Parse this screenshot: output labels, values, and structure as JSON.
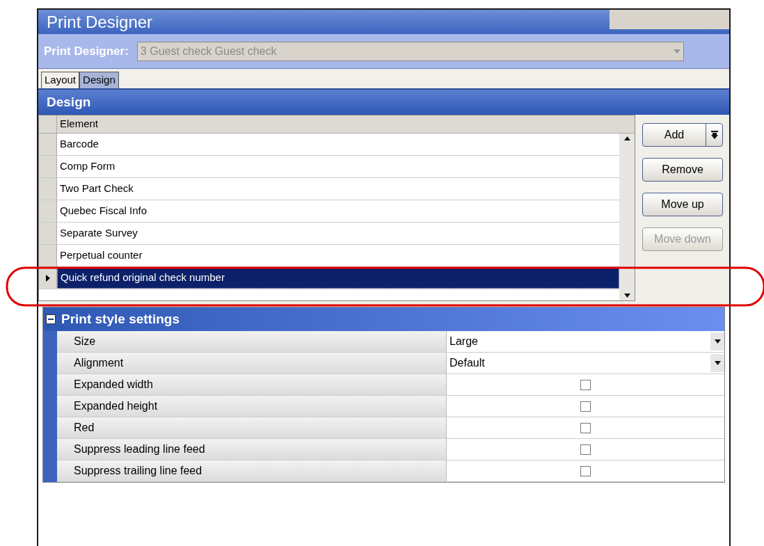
{
  "window": {
    "title": "Print Designer"
  },
  "selector": {
    "label": "Print Designer:",
    "value": "3 Guest check Guest check"
  },
  "tabs": [
    {
      "label": "Layout",
      "selected": false
    },
    {
      "label": "Design",
      "selected": true
    }
  ],
  "design": {
    "title": "Design",
    "column": "Element",
    "rows": [
      {
        "label": "Barcode",
        "selected": false
      },
      {
        "label": "Comp Form",
        "selected": false
      },
      {
        "label": "Two Part Check",
        "selected": false
      },
      {
        "label": "Quebec Fiscal Info",
        "selected": false
      },
      {
        "label": "Separate Survey",
        "selected": false
      },
      {
        "label": "Perpetual counter",
        "selected": false
      },
      {
        "label": "Quick refund original check number",
        "selected": true
      }
    ],
    "buttons": [
      {
        "label": "Add",
        "kind": "split",
        "disabled": false
      },
      {
        "label": "Remove",
        "kind": "plain",
        "disabled": false
      },
      {
        "label": "Move up",
        "kind": "plain",
        "disabled": false
      },
      {
        "label": "Move down",
        "kind": "plain",
        "disabled": true
      }
    ]
  },
  "print_style": {
    "title": "Print style settings",
    "expanded": true,
    "rows": [
      {
        "label": "Size",
        "kind": "dropdown",
        "value": "Large"
      },
      {
        "label": "Alignment",
        "kind": "dropdown",
        "value": "Default"
      },
      {
        "label": "Expanded width",
        "kind": "checkbox",
        "checked": false
      },
      {
        "label": "Expanded height",
        "kind": "checkbox",
        "checked": false
      },
      {
        "label": "Red",
        "kind": "checkbox",
        "checked": false
      },
      {
        "label": "Suppress leading line feed",
        "kind": "checkbox",
        "checked": false
      },
      {
        "label": "Suppress trailing line feed",
        "kind": "checkbox",
        "checked": false
      }
    ]
  }
}
